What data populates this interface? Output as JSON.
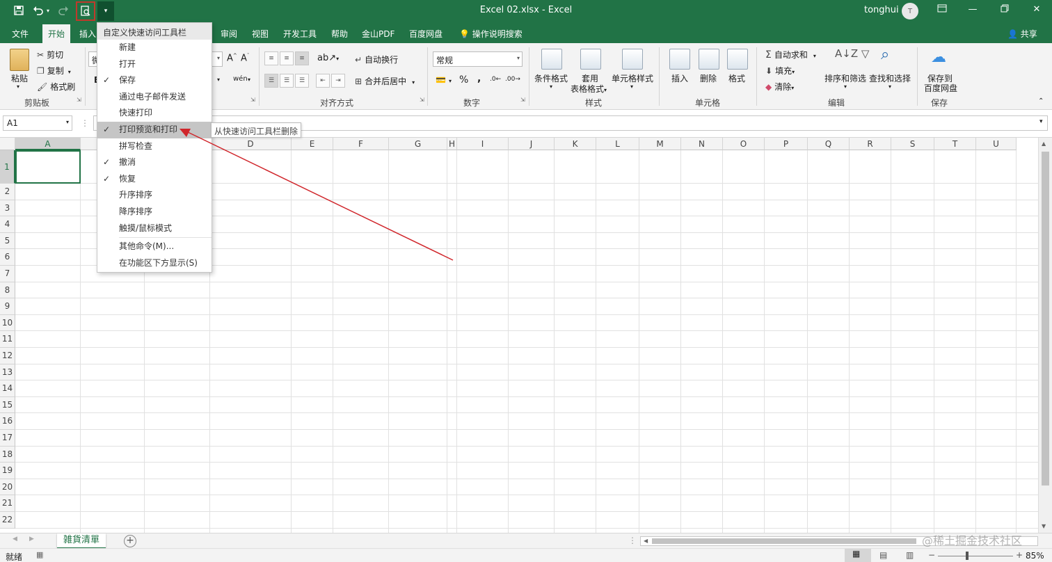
{
  "window": {
    "title": "Excel 02.xlsx  -  Excel",
    "user": "tonghui",
    "avatar_initial": "T"
  },
  "qat": {
    "dropdown_icon": "chevron-down-icon"
  },
  "tabs": [
    "文件",
    "开始",
    "插入",
    "审阅",
    "视图",
    "开发工具",
    "帮助",
    "金山PDF",
    "百度网盘",
    "操作说明搜索"
  ],
  "share_label": "共享",
  "ribbon": {
    "clipboard": {
      "paste": "粘贴",
      "cut": "剪切",
      "copy": "复制",
      "format_painter": "格式刷",
      "label": "剪贴板"
    },
    "font": {
      "font_name_partial": "微",
      "bold_partial": "B"
    },
    "alignment": {
      "wrap": "自动换行",
      "merge": "合并后居中",
      "label": "对齐方式"
    },
    "number": {
      "format": "常规",
      "percent": "%",
      "comma": ",",
      "label": "数字"
    },
    "styles": {
      "conditional": "条件格式",
      "table_format_1": "套用",
      "table_format_2": "表格格式",
      "cell_styles": "单元格样式",
      "label": "样式"
    },
    "cells": {
      "insert": "插入",
      "delete": "删除",
      "format": "格式",
      "label": "单元格"
    },
    "editing": {
      "autosum": "自动求和",
      "fill": "填充",
      "clear": "清除",
      "sort_filter": "排序和筛选",
      "find_select": "查找和选择",
      "label": "编辑"
    },
    "save": {
      "line1": "保存到",
      "line2": "百度网盘",
      "label": "保存"
    }
  },
  "formula_bar": {
    "name_box": "A1"
  },
  "columns": [
    "A",
    "B",
    "C",
    "D",
    "E",
    "F",
    "G",
    "H",
    "I",
    "J",
    "K",
    "L",
    "M",
    "N",
    "O",
    "P",
    "Q",
    "R",
    "S",
    "T",
    "U"
  ],
  "rows": [
    "1",
    "2",
    "3",
    "4",
    "5",
    "6",
    "7",
    "8",
    "9",
    "10",
    "11",
    "12",
    "13",
    "14",
    "15",
    "16",
    "17",
    "18",
    "19",
    "20",
    "21",
    "22"
  ],
  "menu": {
    "header": "自定义快速访问工具栏",
    "items": [
      {
        "label": "新建",
        "checked": false
      },
      {
        "label": "打开",
        "checked": false
      },
      {
        "label": "保存",
        "checked": true
      },
      {
        "label": "通过电子邮件发送",
        "checked": false
      },
      {
        "label": "快速打印",
        "checked": false
      },
      {
        "label": "打印预览和打印",
        "checked": true
      },
      {
        "label": "拼写检查",
        "checked": false
      },
      {
        "label": "撤消",
        "checked": true
      },
      {
        "label": "恢复",
        "checked": true
      },
      {
        "label": "升序排序",
        "checked": false
      },
      {
        "label": "降序排序",
        "checked": false
      },
      {
        "label": "触摸/鼠标模式",
        "checked": false
      }
    ],
    "more_commands": "其他命令(M)...",
    "show_below": "在功能区下方显示(S)",
    "check_mark": "✓"
  },
  "tooltip": "从快速访问工具栏删除",
  "sheet": {
    "tab": "雑貨清單",
    "add": "+"
  },
  "status": {
    "ready": "就绪",
    "zoom": "85%"
  },
  "watermark": "@稀土掘金技术社区",
  "colors": {
    "accent": "#217346",
    "annotation": "#d0262b"
  }
}
